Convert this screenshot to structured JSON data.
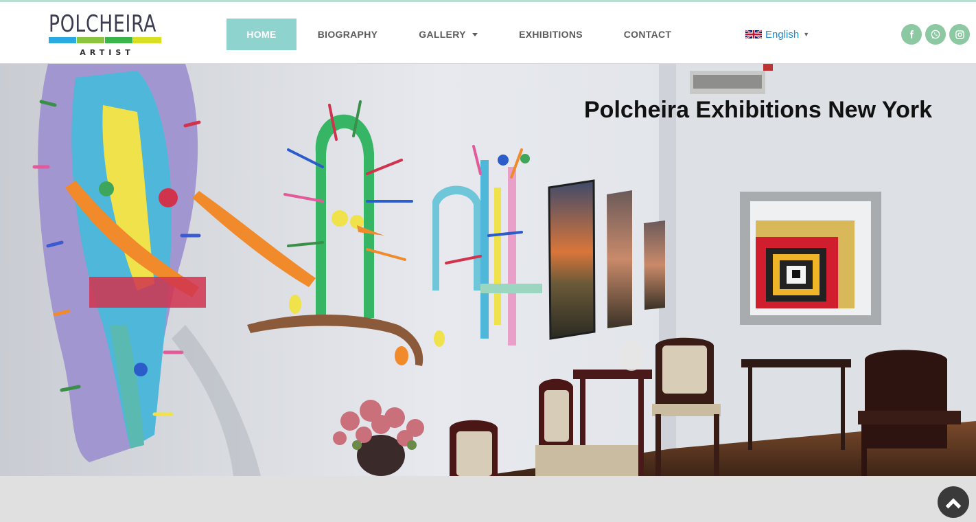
{
  "brand": {
    "name": "POLCHEIRA",
    "tagline": "ARTIST",
    "bar_colors": [
      "#29abe2",
      "#8cc63f",
      "#39b54a",
      "#d9e021"
    ]
  },
  "nav": {
    "items": [
      {
        "label": "HOME",
        "active": true
      },
      {
        "label": "BIOGRAPHY"
      },
      {
        "label": "GALLERY",
        "has_dropdown": true
      },
      {
        "label": "EXHIBITIONS"
      },
      {
        "label": "CONTACT"
      }
    ],
    "active_color": "#8fd3cf"
  },
  "language": {
    "selected": "English",
    "flag_icon": "uk-flag-icon"
  },
  "social": [
    {
      "icon": "facebook-icon"
    },
    {
      "icon": "whatsapp-icon"
    },
    {
      "icon": "instagram-icon"
    }
  ],
  "hero": {
    "title": "Polcheira Exhibitions New York",
    "image_alt": "gallery-room-photo"
  },
  "scroll_top_icon": "chevron-up-icon"
}
